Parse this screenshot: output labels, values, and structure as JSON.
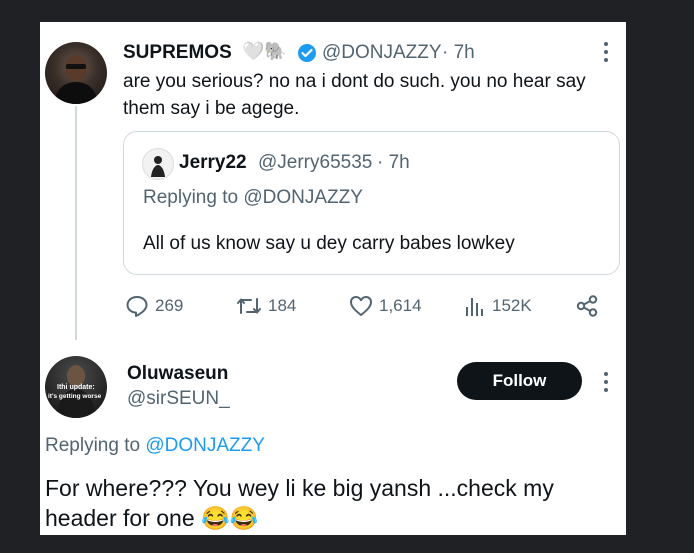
{
  "colors": {
    "brand_blue": "#1d9bf0",
    "text": "#0f1419",
    "muted": "#536471",
    "background": "#202124"
  },
  "tweet": {
    "display_name": "SUPREMOS",
    "name_emojis": "🤍🐘",
    "handle": "@DONJAZZY",
    "time": "· 7h",
    "text_line1": "are you serious? no na i dont do such. you no hear say",
    "text_line2": "them say i be agege.",
    "quote": {
      "display_name": "Jerry22",
      "handle": "@Jerry65535",
      "time": "· 7h",
      "replying_label": "Replying to @DONJAZZY",
      "text": "All of us know say u dey carry babes lowkey"
    },
    "stats": {
      "replies": "269",
      "retweets": "184",
      "likes": "1,614",
      "views": "152K"
    }
  },
  "reply": {
    "display_name": "Oluwaseun",
    "handle": "@sirSEUN_",
    "avatar_text_line1": "Ithi update:",
    "avatar_text_line2": "it's getting worse",
    "follow_label": "Follow",
    "replying_prefix": "Replying to ",
    "replying_handle": "@DONJAZZY",
    "text_line1": "For where??? You wey li ke big yansh ...check my",
    "text_line2": "header for one",
    "text_emojis": "😂😂"
  }
}
